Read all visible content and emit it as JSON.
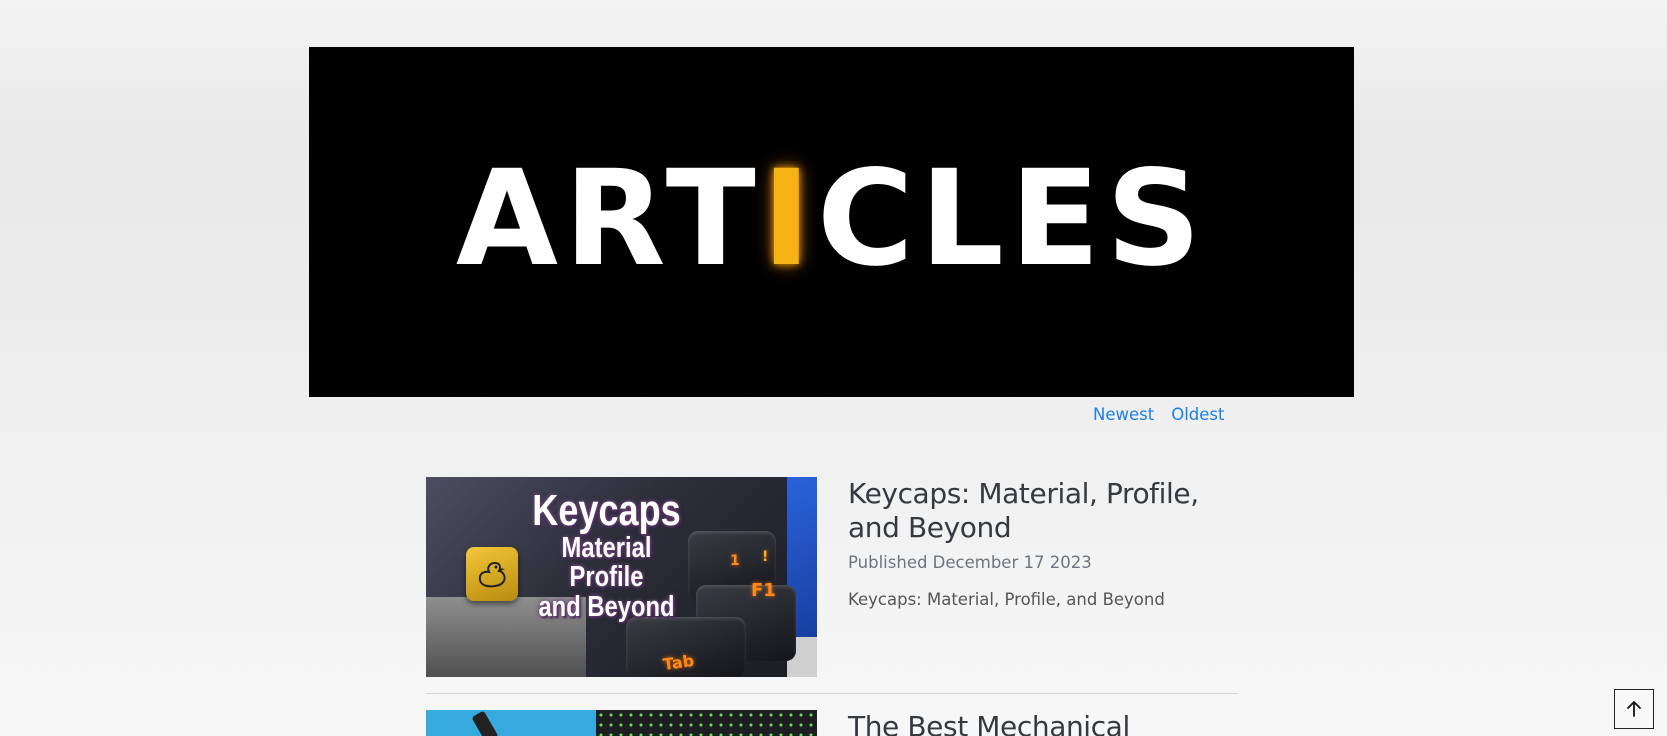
{
  "banner": {
    "title_before": "ART",
    "title_glow": "I",
    "title_after": "CLES"
  },
  "sort": {
    "newest_label": "Newest",
    "oldest_label": "Oldest"
  },
  "articles": [
    {
      "title": "Keycaps: Material, Profile, and Beyond",
      "date": "Published December 17 2023",
      "excerpt": "Keycaps: Material, Profile, and Beyond",
      "thumbnail": {
        "line1": "Keycaps",
        "line2": "Material",
        "line3": "Profile",
        "line4": "and Beyond",
        "key_f1": "F1",
        "key_tab": "Tab",
        "key_1": "1",
        "key_ex": "!"
      }
    },
    {
      "title": "The Best Mechanical"
    }
  ],
  "back_to_top": {
    "icon": "arrow-up-icon",
    "glyph": "↑"
  },
  "colors": {
    "link": "#1a7fe6",
    "banner_bg": "#000000",
    "banner_accent": "#f5b316"
  }
}
